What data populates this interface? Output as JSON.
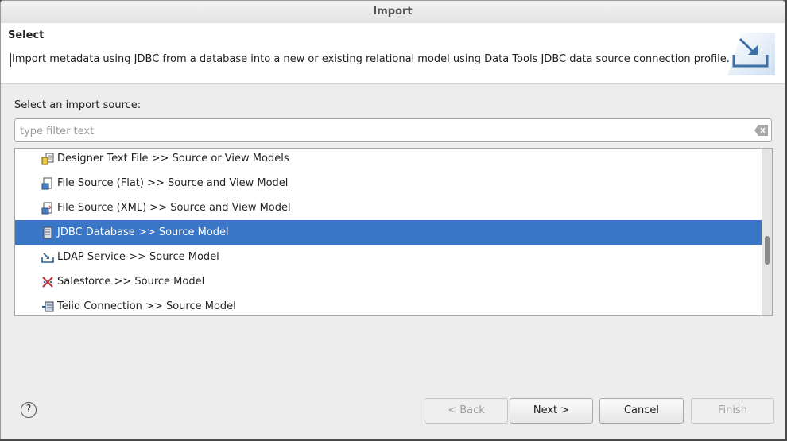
{
  "window": {
    "title": "Import"
  },
  "header": {
    "title": "Select",
    "description": "Import metadata using JDBC from a database into a new or existing relational model using Data Tools JDBC data source connection profile."
  },
  "source": {
    "label": "Select an import source:",
    "filter_placeholder": "type filter text",
    "filter_value": ""
  },
  "list": {
    "items": [
      {
        "label": "Designer Text File >> Source or View Models",
        "icon": "text-file-icon"
      },
      {
        "label": "File Source (Flat) >> Source and View Model",
        "icon": "flat-file-icon"
      },
      {
        "label": "File Source (XML) >> Source and View Model",
        "icon": "xml-file-icon"
      },
      {
        "label": "JDBC Database >> Source Model",
        "icon": "database-icon",
        "selected": true
      },
      {
        "label": "LDAP Service >> Source Model",
        "icon": "ldap-icon"
      },
      {
        "label": "Salesforce >> Source Model",
        "icon": "salesforce-icon"
      },
      {
        "label": "Teiid Connection >> Source Model",
        "icon": "teiid-icon"
      }
    ]
  },
  "buttons": {
    "help": "?",
    "back": "< Back",
    "next": "Next >",
    "cancel": "Cancel",
    "finish": "Finish"
  },
  "colors": {
    "selection": "#3a76c6",
    "dialog_bg": "#ededed"
  }
}
